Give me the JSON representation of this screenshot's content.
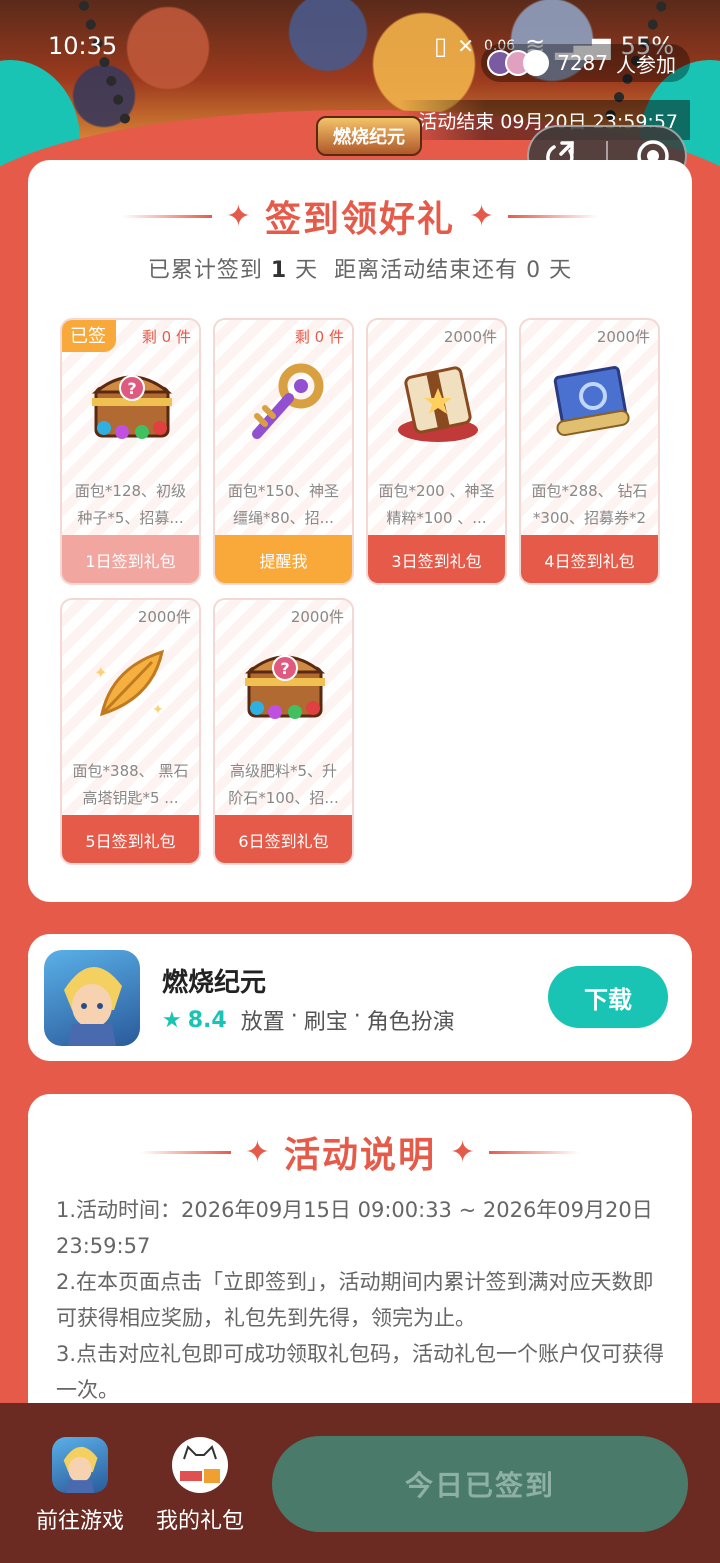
{
  "status_bar": {
    "time": "10:35",
    "net_speed": "0.06",
    "battery": "55%"
  },
  "hero": {
    "participants_count": "7287",
    "participants_suffix": "人参加",
    "end_time_label": "活动结束",
    "end_time_value": "09月20日 23:59:57",
    "game_logo_text": "燃烧纪元"
  },
  "signin": {
    "title": "签到领好礼",
    "summary_prefix": "已累计签到",
    "summary_days": "1",
    "summary_mid": "天  距离活动结束还有",
    "summary_remaining": "0",
    "summary_suffix": "天",
    "gifts": [
      {
        "stock": "剩 0 件",
        "tag": "已签",
        "desc": "面包*128、初级种子*5、招募...",
        "button": "1日签到礼包",
        "icon": "treasure-chest-icon"
      },
      {
        "stock": "剩 0 件",
        "tag": "",
        "desc": "面包*150、神圣缰绳*80、招...",
        "button": "提醒我",
        "icon": "key-icon"
      },
      {
        "stock": "2000件",
        "tag": "",
        "desc": "面包*200 、神圣精粹*100 、...",
        "button": "3日签到礼包",
        "icon": "gift-box-icon"
      },
      {
        "stock": "2000件",
        "tag": "",
        "desc": "面包*288、 钻石*300、招募券*2",
        "button": "4日签到礼包",
        "icon": "scroll-icon"
      },
      {
        "stock": "2000件",
        "tag": "",
        "desc": "面包*388、 黑石高塔钥匙*5 ...",
        "button": "5日签到礼包",
        "icon": "feather-icon"
      },
      {
        "stock": "2000件",
        "tag": "",
        "desc": "高级肥料*5、升阶石*100、招...",
        "button": "6日签到礼包",
        "icon": "treasure-chest-icon"
      }
    ]
  },
  "game": {
    "name": "燃烧纪元",
    "rating": "8.4",
    "tags": [
      "放置",
      "刷宝",
      "角色扮演"
    ],
    "download_label": "下载"
  },
  "rules": {
    "title": "活动说明",
    "lines": [
      "1.活动时间：2026年09月15日 09:00:33 ~ 2026年09月20日 23:59:57",
      "2.在本页面点击「立即签到」，活动期间内累计签到满对应天数即可获得相应奖励，礼包先到先得，领完为止。",
      "3.点击对应礼包即可成功领取礼包码，活动礼包一个账户仅可获得一次。"
    ]
  },
  "bottom_bar": {
    "go_game_label": "前往游戏",
    "my_gifts_label": "我的礼包",
    "checkin_label": "今日已签到"
  },
  "colors": {
    "primary_red": "#E65A49",
    "teal": "#19C4B4",
    "orange": "#F8A93A",
    "bottom_bar": "#6B2A22",
    "disabled_button": "#4A7A6A"
  }
}
